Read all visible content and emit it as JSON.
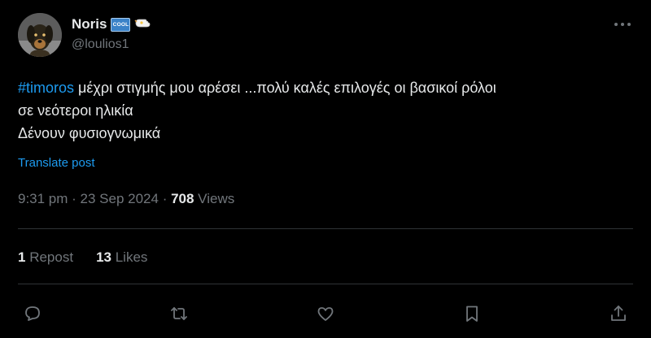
{
  "author": {
    "display_name": "Noris",
    "badge_text": "COOL",
    "handle": "@loulios1",
    "avatar_icon": "dog-avatar"
  },
  "tweet": {
    "hashtag": "#timoros",
    "line1_rest": " μέχρι στιγμής μου αρέσει ...πολύ καλές επιλογές οι βασικοί ρόλοι",
    "line2": "σε νεότεροι ηλικία",
    "line3": "Δένουν φυσιογνωμικά"
  },
  "translate_label": "Translate post",
  "meta": {
    "time": "9:31 pm",
    "sep1": " · ",
    "date": "23 Sep 2024",
    "sep2": " · ",
    "views_count": "708",
    "views_label": " Views"
  },
  "stats": {
    "reposts_count": "1",
    "reposts_label": " Repost",
    "likes_count": "13",
    "likes_label": " Likes"
  },
  "icons": {
    "more": "more-icon",
    "reply": "reply-icon",
    "repost": "repost-icon",
    "like": "heart-icon",
    "bookmark": "bookmark-icon",
    "share": "share-icon"
  },
  "colors": {
    "background": "#000000",
    "text": "#e7e9ea",
    "muted": "#71767b",
    "accent": "#1d9bf0",
    "divider": "#2f3336"
  }
}
